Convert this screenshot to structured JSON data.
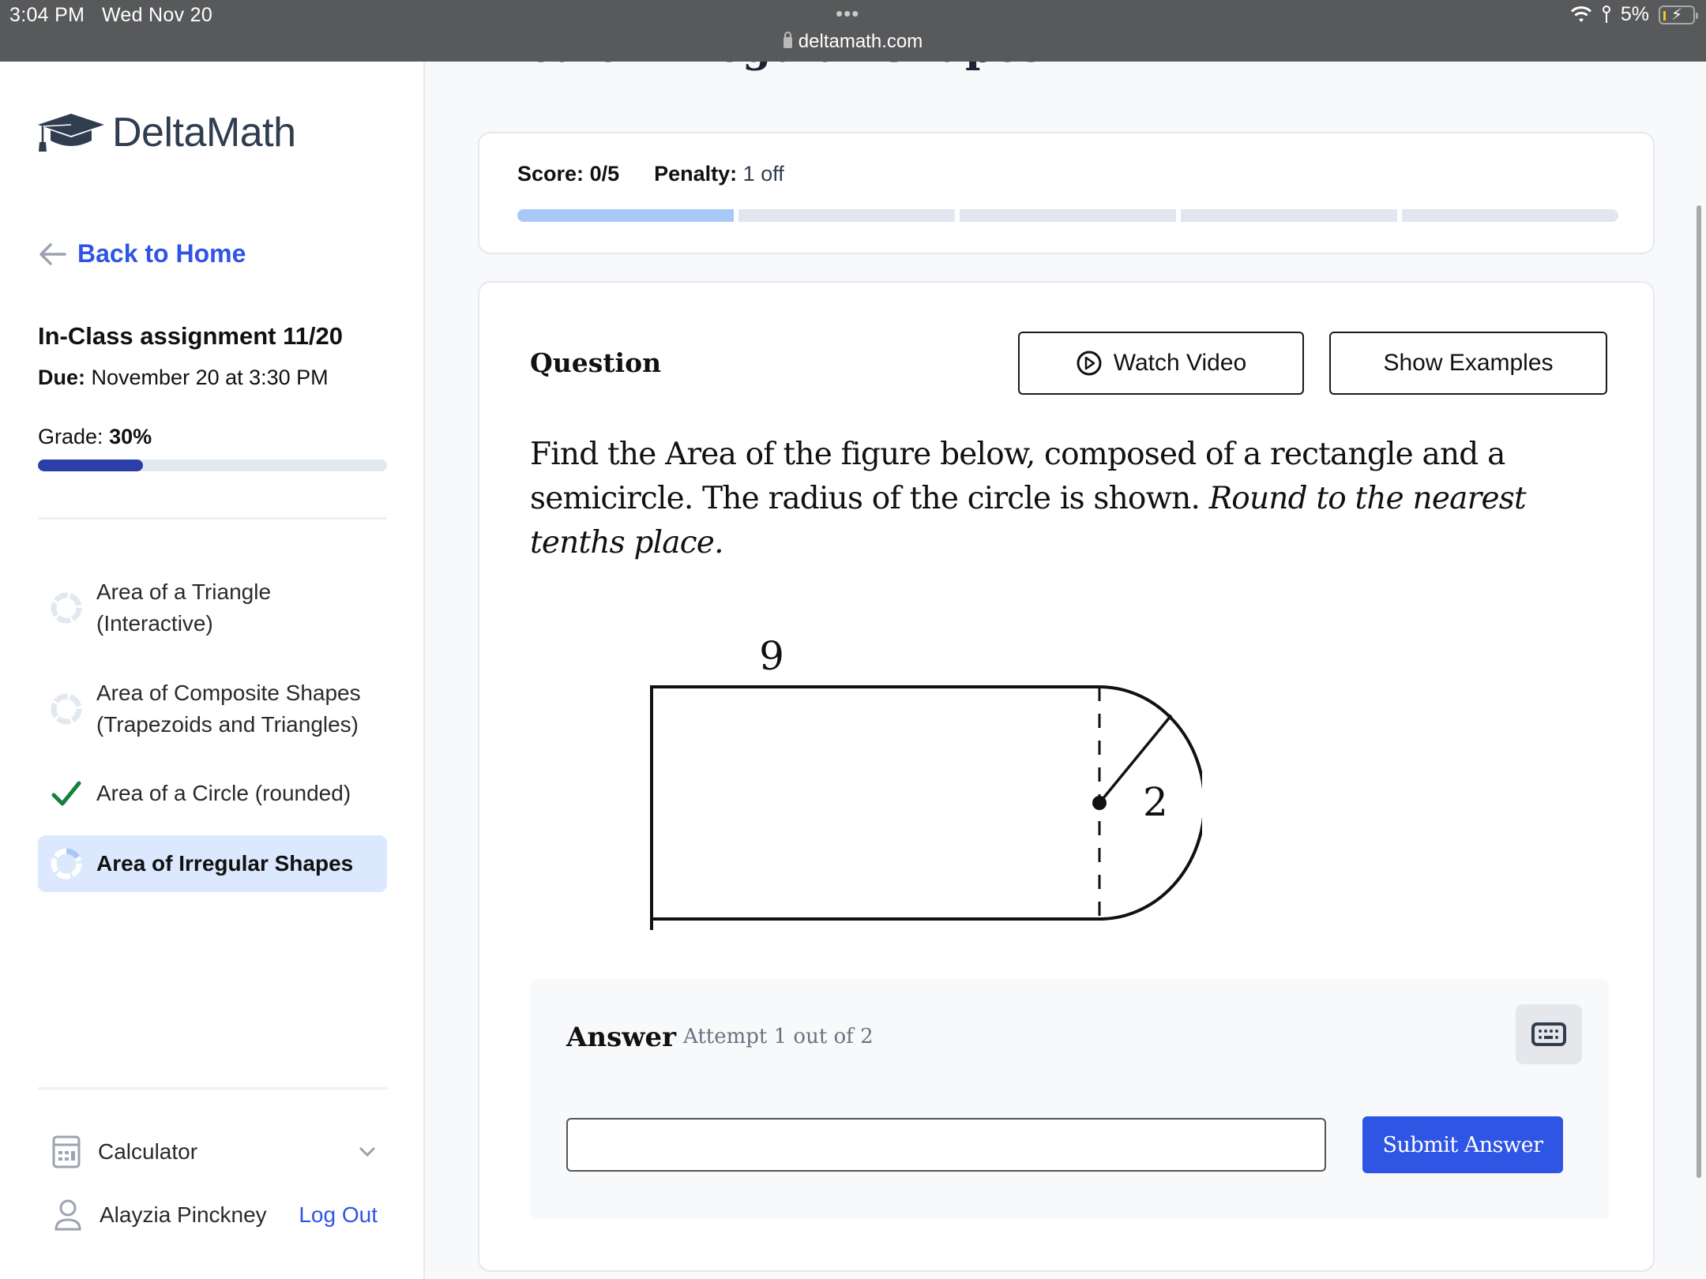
{
  "status_bar": {
    "time": "3:04 PM",
    "date": "Wed Nov 20",
    "url": "deltamath.com",
    "battery": "5%",
    "battery_level": 0.05
  },
  "sidebar": {
    "brand_bold": "Delta",
    "brand_light": "Math",
    "back_link": "Back to Home",
    "assignment_title": "In-Class assignment 11/20",
    "due_label": "Due:",
    "due_value": "November 20 at 3:30 PM",
    "grade_label": "Grade:",
    "grade_value": "30%",
    "grade_fraction": 0.3,
    "skills": [
      {
        "line1": "Area of a Triangle",
        "line2": "(Interactive)",
        "status": "not-started"
      },
      {
        "line1": "Area of Composite Shapes",
        "line2": "(Trapezoids and Triangles)",
        "status": "not-started"
      },
      {
        "line1": "Area of a Circle (rounded)",
        "line2": "",
        "status": "completed"
      },
      {
        "line1": "Area of Irregular Shapes",
        "line2": "",
        "status": "in-progress-active"
      }
    ],
    "calculator_label": "Calculator",
    "user_name": "Alayzia Pinckney",
    "logout_label": "Log Out"
  },
  "main": {
    "page_title": "Area of Irregular Shapes",
    "score_label": "Score:",
    "score_value": "0/5",
    "penalty_label": "Penalty:",
    "penalty_value": "1 off",
    "progress_segments": 5,
    "progress_filled": 1,
    "question_heading": "Question",
    "watch_video_label": "Watch Video",
    "show_examples_label": "Show Examples",
    "question_text": "Find the Area of the figure below, composed of a rectangle and a semicircle. The radius of the circle is shown.",
    "question_instruction": "Round to the nearest tenths place.",
    "figure": {
      "rect_length_label": "9",
      "radius_label": "2"
    },
    "answer_label": "Answer",
    "attempt_text": "Attempt 1 out of 2",
    "answer_value": "",
    "answer_placeholder": "",
    "submit_label": "Submit Answer"
  },
  "colors": {
    "accent": "#2f55e4",
    "grade_fill": "#2b3fa8",
    "progress_fill": "#a8c8f7",
    "active_skill_bg": "#dbe8fd",
    "check_green": "#15803d"
  }
}
